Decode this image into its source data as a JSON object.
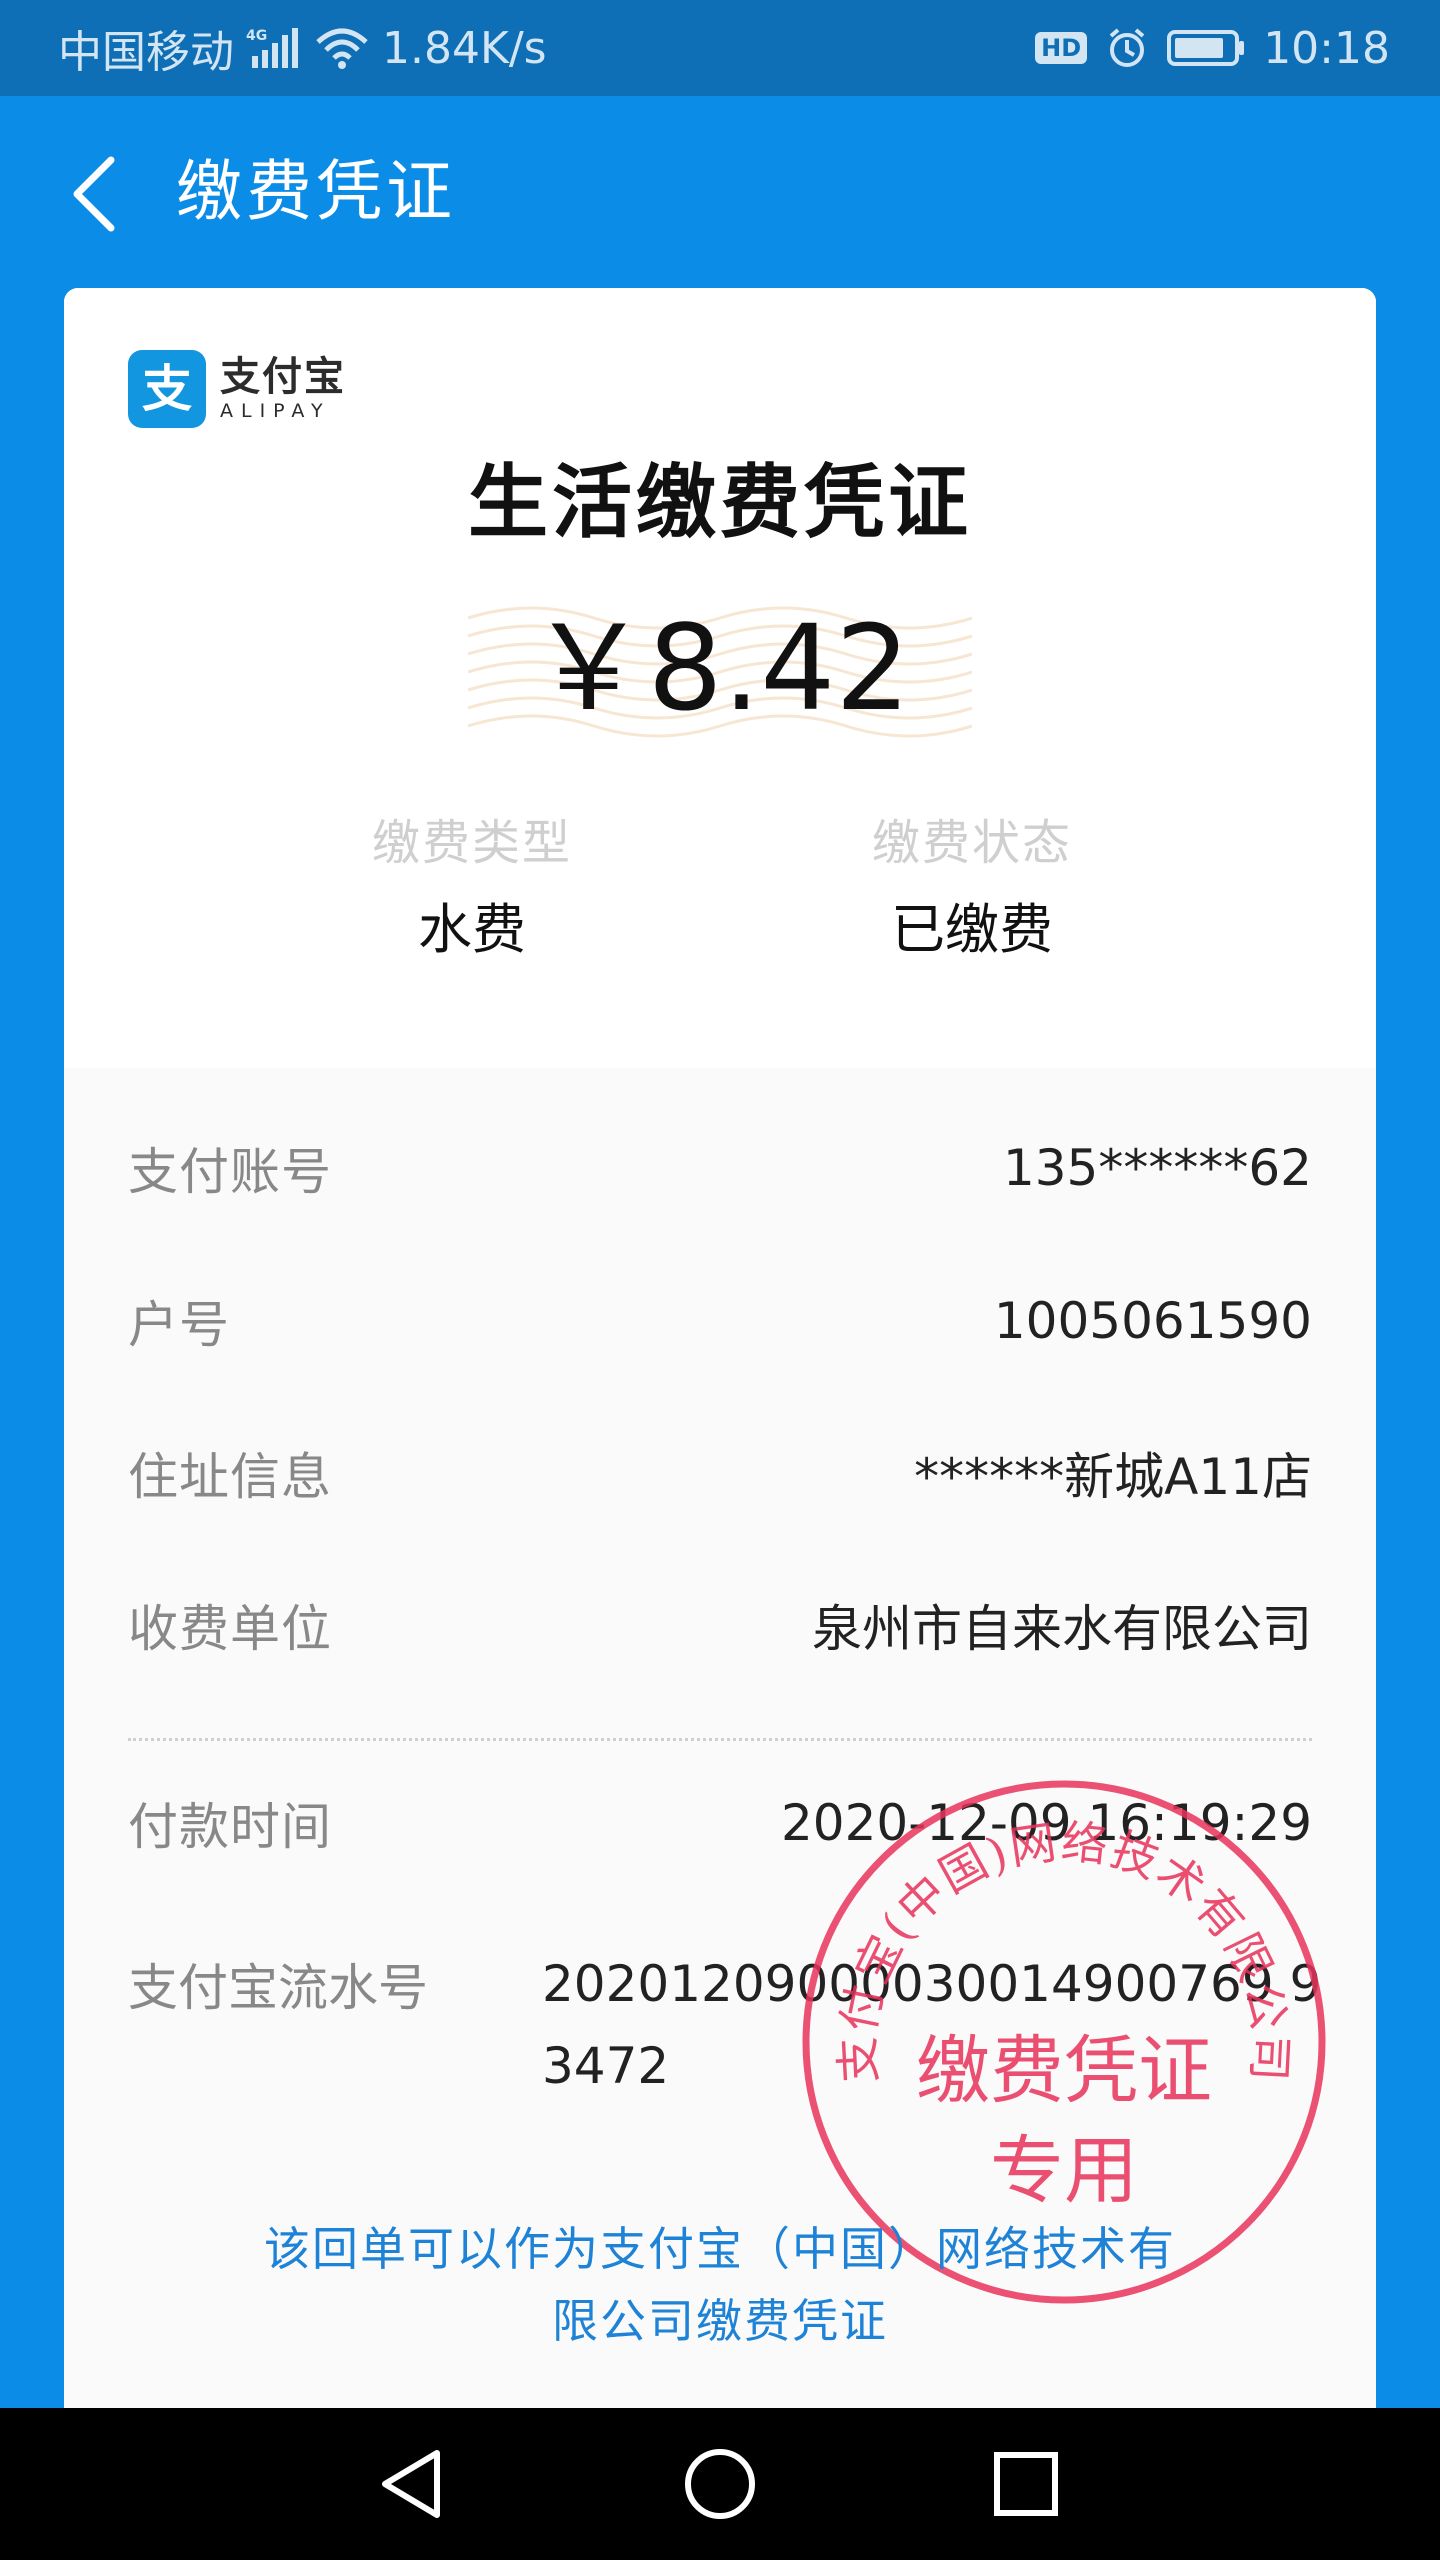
{
  "status_bar": {
    "carrier": "中国移动",
    "network_badge": "4G",
    "speed": "1.84K/s",
    "hd_badge": "HD",
    "time": "10:18",
    "icons": [
      "signal-icon",
      "wifi-icon",
      "alarm-icon",
      "battery-icon"
    ]
  },
  "header": {
    "title": "缴费凭证",
    "back_icon": "chevron-left-icon",
    "color": "#0b8ce6"
  },
  "receipt": {
    "logo": {
      "name_cn": "支付宝",
      "name_en": "ALIPAY",
      "mark": "支",
      "color": "#1296e0"
    },
    "title": "生活缴费凭证",
    "amount": "￥8.42",
    "summary": [
      {
        "label": "缴费类型",
        "value": "水费"
      },
      {
        "label": "缴费状态",
        "value": "已缴费"
      }
    ],
    "details": [
      {
        "label": "支付账号",
        "value": "135******62"
      },
      {
        "label": "户号",
        "value": "1005061590"
      },
      {
        "label": "住址信息",
        "value": "******新城A11店"
      },
      {
        "label": "收费单位",
        "value": "泉州市自来水有限公司"
      }
    ],
    "payment_time": {
      "label": "付款时间",
      "value": "2020-12-09 16:19:29"
    },
    "serial": {
      "label": "支付宝流水号",
      "value": "20201209000030014900769 93472"
    },
    "seal": {
      "ring_text": "支付宝(中国)网络技术有限公司",
      "line1": "缴费凭证",
      "line2": "专用",
      "color": "#e8325a"
    },
    "footer_note_line1": "该回单可以作为支付宝（中国）网络技术有",
    "footer_note_line2": "限公司缴费凭证",
    "note_color": "#1e83d6"
  },
  "nav_bar": {
    "buttons": [
      "back-triangle-icon",
      "home-circle-icon",
      "recents-square-icon"
    ]
  }
}
